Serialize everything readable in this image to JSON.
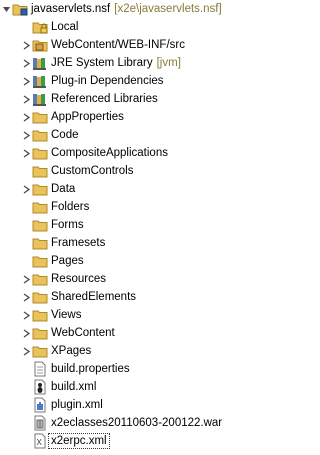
{
  "tree": {
    "root": {
      "label": "javaservlets.nsf",
      "decoration": "[x2e\\javaservlets.nsf]",
      "icon": "nsf-project-icon",
      "expanded": true
    },
    "items": [
      {
        "label": "Local",
        "icon": "lock-folder-icon",
        "arrow": false
      },
      {
        "label": "WebContent/WEB-INF/src",
        "icon": "source-folder-icon",
        "arrow": true
      },
      {
        "label": "JRE System Library",
        "decoration": "[jvm]",
        "icon": "library-icon",
        "arrow": true
      },
      {
        "label": "Plug-in Dependencies",
        "icon": "library-icon",
        "arrow": true
      },
      {
        "label": "Referenced Libraries",
        "icon": "library-icon",
        "arrow": true
      },
      {
        "label": "AppProperties",
        "icon": "folder-icon",
        "arrow": true
      },
      {
        "label": "Code",
        "icon": "folder-icon",
        "arrow": true
      },
      {
        "label": "CompositeApplications",
        "icon": "folder-icon",
        "arrow": true
      },
      {
        "label": "CustomControls",
        "icon": "folder-icon",
        "arrow": false
      },
      {
        "label": "Data",
        "icon": "folder-icon",
        "arrow": true
      },
      {
        "label": "Folders",
        "icon": "folder-icon",
        "arrow": false
      },
      {
        "label": "Forms",
        "icon": "folder-icon",
        "arrow": false
      },
      {
        "label": "Framesets",
        "icon": "folder-icon",
        "arrow": false
      },
      {
        "label": "Pages",
        "icon": "folder-icon",
        "arrow": false
      },
      {
        "label": "Resources",
        "icon": "folder-icon",
        "arrow": true
      },
      {
        "label": "SharedElements",
        "icon": "folder-icon",
        "arrow": true
      },
      {
        "label": "Views",
        "icon": "folder-icon",
        "arrow": true
      },
      {
        "label": "WebContent",
        "icon": "folder-icon",
        "arrow": true
      },
      {
        "label": "XPages",
        "icon": "folder-icon",
        "arrow": true
      },
      {
        "label": "build.properties",
        "icon": "properties-file-icon",
        "arrow": false
      },
      {
        "label": "build.xml",
        "icon": "ant-xml-file-icon",
        "arrow": false
      },
      {
        "label": "plugin.xml",
        "icon": "plugin-xml-file-icon",
        "arrow": false
      },
      {
        "label": "x2eclasses20110603-200122.war",
        "icon": "war-file-icon",
        "arrow": false
      },
      {
        "label": "x2erpc.xml",
        "icon": "xml-file-icon",
        "arrow": false,
        "selected": true
      }
    ]
  },
  "colors": {
    "folder": "#e9c35a",
    "decoration": "#8a7a3a"
  }
}
